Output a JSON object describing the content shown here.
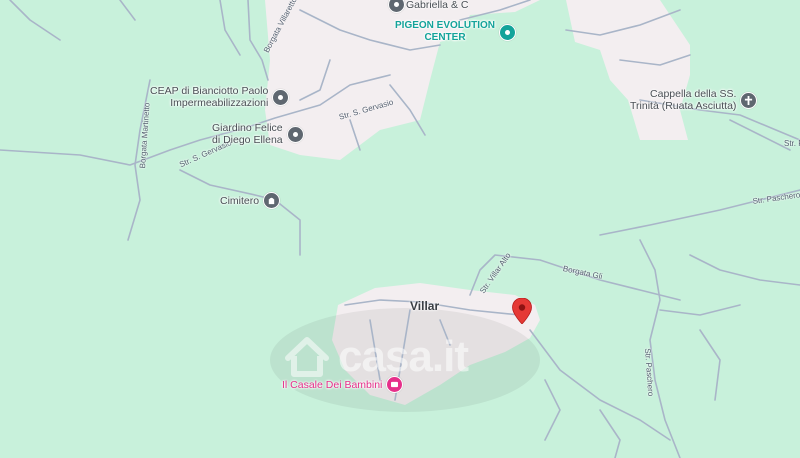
{
  "map": {
    "colors": {
      "land": "#c8f1db",
      "urban": "#f3eef0",
      "road": "#a9b5c8",
      "teal_poi": "#13a39a",
      "pink_poi": "#e62f8a",
      "pin": "#e53935"
    },
    "place_label": "Villar",
    "watermark": "casa.it",
    "pois": [
      {
        "label_lines": [
          "Gabriella & C"
        ],
        "icon": "place-icon",
        "color": "#5f6770"
      },
      {
        "label_lines": [
          "PIGEON EVOLUTION",
          "CENTER"
        ],
        "icon": "place-icon",
        "color": "#13a39a"
      },
      {
        "label_lines": [
          "CEAP di Bianciotto Paolo",
          "Impermeabilizzazioni"
        ],
        "icon": "place-icon",
        "color": "#5f6770"
      },
      {
        "label_lines": [
          "Giardino Felice",
          "di Diego Ellena"
        ],
        "icon": "place-icon",
        "color": "#5f6770"
      },
      {
        "label_lines": [
          "Cimitero"
        ],
        "icon": "cemetery-icon",
        "color": "#5f6770"
      },
      {
        "label_lines": [
          "Cappella della SS.",
          "Trinità (Ruata Asciutta)"
        ],
        "icon": "church-icon",
        "color": "#5f6770"
      },
      {
        "label_lines": [
          "Il Casale Dei Bambini"
        ],
        "icon": "school-icon",
        "color": "#e62f8a"
      }
    ],
    "roads": [
      "Borgata Villaretto",
      "Str. S. Gervasio",
      "Str. S. Gervasio",
      "Borgata Martinetto",
      "Str. Paschero",
      "Str. Villar Alto",
      "Borgata Gli",
      "Str. Paschero",
      "Str. F"
    ]
  }
}
